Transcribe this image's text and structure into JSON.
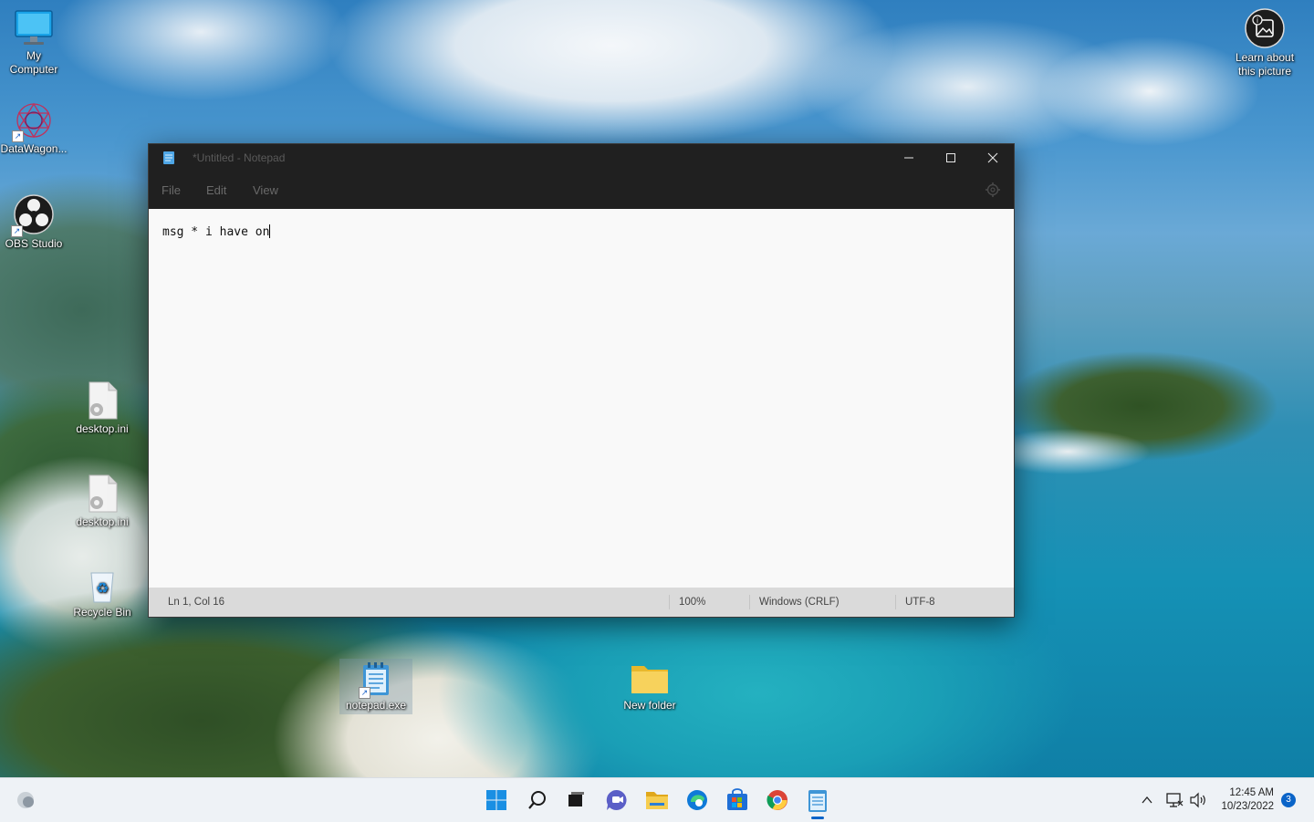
{
  "desktop": {
    "icons": [
      {
        "label": "My\nComputer"
      },
      {
        "label": "DataWagon..."
      },
      {
        "label": "OBS Studio"
      },
      {
        "label": "desktop.ini"
      },
      {
        "label": "desktop.ini"
      },
      {
        "label": "Recycle Bin"
      },
      {
        "label": "notepad.exe"
      },
      {
        "label": "New folder"
      }
    ],
    "spotlight": {
      "label": "Learn about\nthis picture"
    }
  },
  "notepad": {
    "title": "*Untitled - Notepad",
    "menu": [
      "File",
      "Edit",
      "View"
    ],
    "content": "msg * i have on",
    "status": {
      "position": "Ln 1, Col 16",
      "zoom": "100%",
      "line_ending": "Windows (CRLF)",
      "encoding": "UTF-8"
    }
  },
  "taskbar": {
    "apps": [
      "start-icon",
      "search-icon",
      "task-view-icon",
      "chat-icon",
      "file-explorer-icon",
      "edge-icon",
      "store-icon",
      "chrome-icon",
      "notepad-icon"
    ],
    "clock": {
      "time": "12:45 AM",
      "date": "10/23/2022"
    },
    "notification_count": "3"
  },
  "colors": {
    "titlebar": "#202020",
    "editor_bg": "#f9f9f9",
    "statusbar": "#dadada",
    "taskbar": "#eef2f6",
    "accent": "#0a64c8"
  }
}
